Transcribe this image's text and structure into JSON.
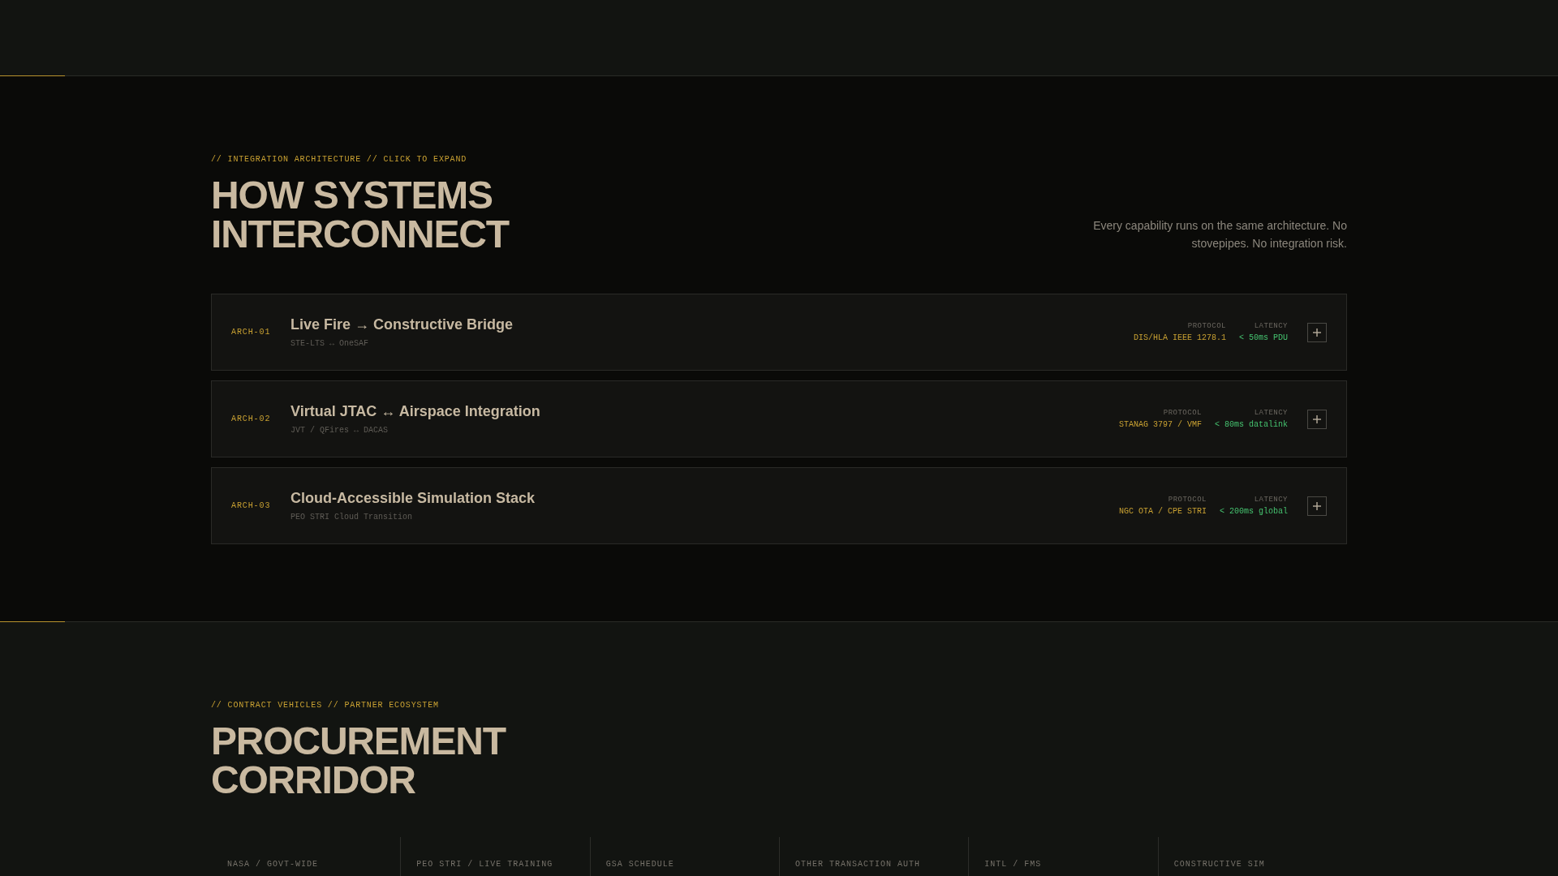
{
  "integration": {
    "eyebrow": "// INTEGRATION ARCHITECTURE // CLICK TO EXPAND",
    "title": "HOW SYSTEMS INTERCONNECT",
    "description": "Every capability runs on the same architecture. No stovepipes. No integration risk.",
    "cards": [
      {
        "id": "ARCH-01",
        "title": "Live Fire → Constructive Bridge",
        "subtitle": "STE-LTS ↔ OneSAF",
        "protocol_label": "PROTOCOL",
        "protocol": "DIS/HLA IEEE 1278.1",
        "latency_label": "LATENCY",
        "latency": "< 50ms PDU",
        "expanded": false
      },
      {
        "id": "ARCH-02",
        "title": "Virtual JTAC ↔ Airspace Integration",
        "subtitle": "JVT / QFires ↔ DACAS",
        "protocol_label": "PROTOCOL",
        "protocol": "STANAG 3797 / VMF",
        "latency_label": "LATENCY",
        "latency": "< 80ms datalink",
        "expanded": false
      },
      {
        "id": "ARCH-03",
        "title": "Cloud-Accessible Simulation Stack",
        "subtitle": "PEO STRI Cloud Transition",
        "protocol_label": "PROTOCOL",
        "protocol": "NGC OTA / CPE STRI",
        "latency_label": "LATENCY",
        "latency": "< 200ms global",
        "expanded": false
      }
    ]
  },
  "procurement": {
    "eyebrow": "// CONTRACT VEHICLES // PARTNER ECOSYSTEM",
    "title": "PROCUREMENT CORRIDOR",
    "vehicles": [
      "NASA / GOVT-WIDE",
      "PEO STRI / LIVE TRAINING",
      "GSA SCHEDULE",
      "OTHER TRANSACTION AUTH",
      "INTL / FMS",
      "CONSTRUCTIVE SIM"
    ]
  }
}
